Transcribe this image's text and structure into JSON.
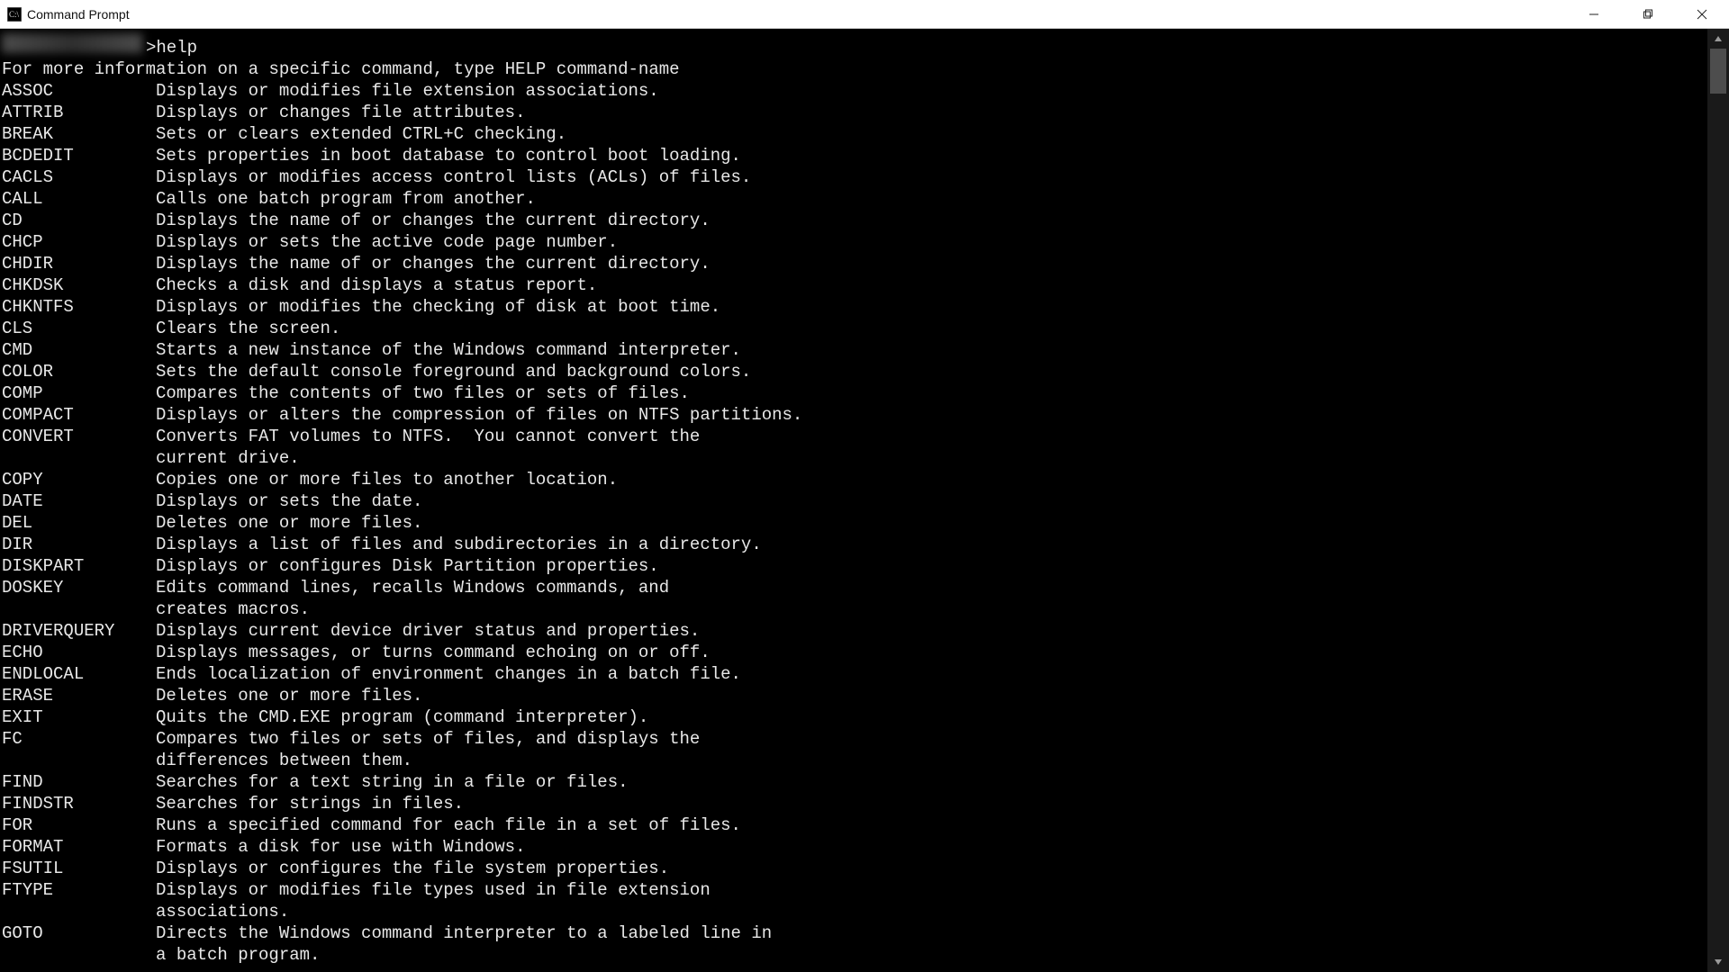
{
  "window": {
    "title": "Command Prompt"
  },
  "prompt": {
    "typed": ">help"
  },
  "intro": "For more information on a specific command, type HELP command-name",
  "commands": [
    {
      "name": "ASSOC",
      "desc": [
        "Displays or modifies file extension associations."
      ]
    },
    {
      "name": "ATTRIB",
      "desc": [
        "Displays or changes file attributes."
      ]
    },
    {
      "name": "BREAK",
      "desc": [
        "Sets or clears extended CTRL+C checking."
      ]
    },
    {
      "name": "BCDEDIT",
      "desc": [
        "Sets properties in boot database to control boot loading."
      ]
    },
    {
      "name": "CACLS",
      "desc": [
        "Displays or modifies access control lists (ACLs) of files."
      ]
    },
    {
      "name": "CALL",
      "desc": [
        "Calls one batch program from another."
      ]
    },
    {
      "name": "CD",
      "desc": [
        "Displays the name of or changes the current directory."
      ]
    },
    {
      "name": "CHCP",
      "desc": [
        "Displays or sets the active code page number."
      ]
    },
    {
      "name": "CHDIR",
      "desc": [
        "Displays the name of or changes the current directory."
      ]
    },
    {
      "name": "CHKDSK",
      "desc": [
        "Checks a disk and displays a status report."
      ]
    },
    {
      "name": "CHKNTFS",
      "desc": [
        "Displays or modifies the checking of disk at boot time."
      ]
    },
    {
      "name": "CLS",
      "desc": [
        "Clears the screen."
      ]
    },
    {
      "name": "CMD",
      "desc": [
        "Starts a new instance of the Windows command interpreter."
      ]
    },
    {
      "name": "COLOR",
      "desc": [
        "Sets the default console foreground and background colors."
      ]
    },
    {
      "name": "COMP",
      "desc": [
        "Compares the contents of two files or sets of files."
      ]
    },
    {
      "name": "COMPACT",
      "desc": [
        "Displays or alters the compression of files on NTFS partitions."
      ]
    },
    {
      "name": "CONVERT",
      "desc": [
        "Converts FAT volumes to NTFS.  You cannot convert the",
        "current drive."
      ]
    },
    {
      "name": "COPY",
      "desc": [
        "Copies one or more files to another location."
      ]
    },
    {
      "name": "DATE",
      "desc": [
        "Displays or sets the date."
      ]
    },
    {
      "name": "DEL",
      "desc": [
        "Deletes one or more files."
      ]
    },
    {
      "name": "DIR",
      "desc": [
        "Displays a list of files and subdirectories in a directory."
      ]
    },
    {
      "name": "DISKPART",
      "desc": [
        "Displays or configures Disk Partition properties."
      ]
    },
    {
      "name": "DOSKEY",
      "desc": [
        "Edits command lines, recalls Windows commands, and",
        "creates macros."
      ]
    },
    {
      "name": "DRIVERQUERY",
      "desc": [
        "Displays current device driver status and properties."
      ]
    },
    {
      "name": "ECHO",
      "desc": [
        "Displays messages, or turns command echoing on or off."
      ]
    },
    {
      "name": "ENDLOCAL",
      "desc": [
        "Ends localization of environment changes in a batch file."
      ]
    },
    {
      "name": "ERASE",
      "desc": [
        "Deletes one or more files."
      ]
    },
    {
      "name": "EXIT",
      "desc": [
        "Quits the CMD.EXE program (command interpreter)."
      ]
    },
    {
      "name": "FC",
      "desc": [
        "Compares two files or sets of files, and displays the",
        "differences between them."
      ]
    },
    {
      "name": "FIND",
      "desc": [
        "Searches for a text string in a file or files."
      ]
    },
    {
      "name": "FINDSTR",
      "desc": [
        "Searches for strings in files."
      ]
    },
    {
      "name": "FOR",
      "desc": [
        "Runs a specified command for each file in a set of files."
      ]
    },
    {
      "name": "FORMAT",
      "desc": [
        "Formats a disk for use with Windows."
      ]
    },
    {
      "name": "FSUTIL",
      "desc": [
        "Displays or configures the file system properties."
      ]
    },
    {
      "name": "FTYPE",
      "desc": [
        "Displays or modifies file types used in file extension",
        "associations."
      ]
    },
    {
      "name": "GOTO",
      "desc": [
        "Directs the Windows command interpreter to a labeled line in",
        "a batch program."
      ]
    }
  ]
}
